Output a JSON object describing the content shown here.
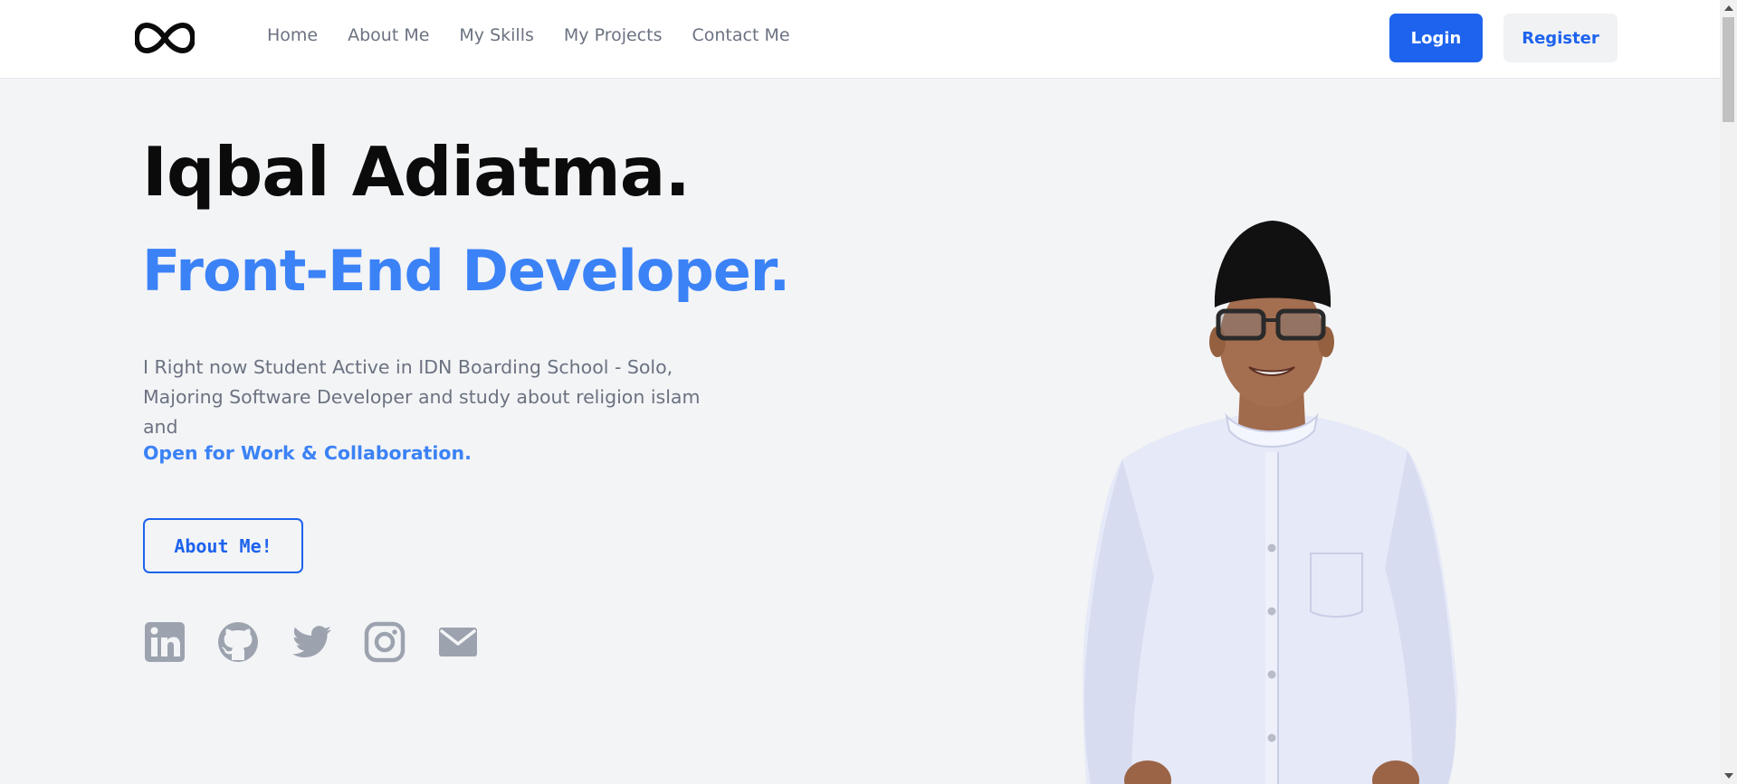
{
  "nav": {
    "logo_icon": "infinity-logo-icon",
    "links": [
      "Home",
      "About Me",
      "My Skills",
      "My Projects",
      "Contact Me"
    ],
    "login_label": "Login",
    "register_label": "Register"
  },
  "hero": {
    "name": "Iqbal Adiatma.",
    "role": "Front-End Developer.",
    "description": "I Right now Student Active in IDN Boarding School - Solo, Majoring Software Developer and study about religion islam and",
    "cta_text": "Open for Work & Collaboration.",
    "about_button_label": "About Me!",
    "portrait": "portrait-photo"
  },
  "socials": [
    {
      "icon": "linkedin-icon"
    },
    {
      "icon": "github-icon"
    },
    {
      "icon": "twitter-icon"
    },
    {
      "icon": "instagram-icon"
    },
    {
      "icon": "email-icon"
    }
  ],
  "colors": {
    "primary": "#1d63ed",
    "accent_text": "#3b82f6",
    "background": "#f3f4f6",
    "muted_text": "#6b7280",
    "icon_gray": "#9ca3af"
  }
}
